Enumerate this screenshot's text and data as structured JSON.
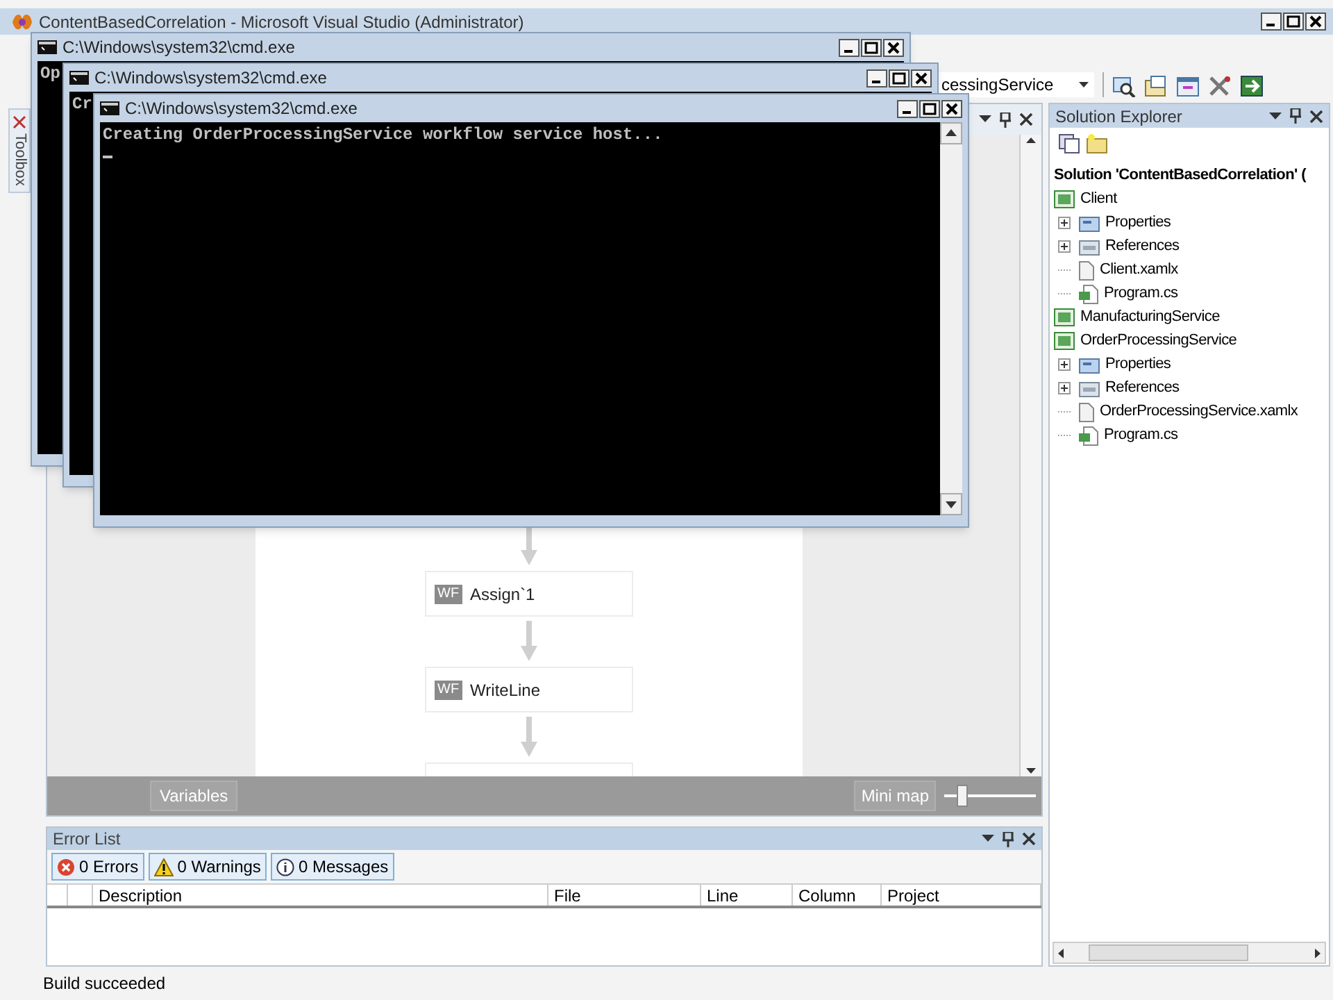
{
  "window": {
    "title": "ContentBasedCorrelation - Microsoft Visual Studio (Administrator)"
  },
  "toolbar": {
    "dropdown": "cessingService"
  },
  "toolbox": {
    "label": "Toolbox"
  },
  "designer": {
    "activities": [
      {
        "icon_label": "WF",
        "label": "Assign`1"
      },
      {
        "icon_label": "WF",
        "label": "WriteLine"
      }
    ],
    "variables_button": "Variables",
    "minimap_button": "Mini map",
    "zoom": {
      "level": 0.15
    }
  },
  "error_list": {
    "title": "Error List",
    "filters": [
      {
        "kind": "error",
        "label": "0 Errors",
        "selected": true
      },
      {
        "kind": "warning",
        "label": "0 Warnings",
        "selected": true
      },
      {
        "kind": "message",
        "label": "0 Messages",
        "selected": true
      }
    ],
    "columns": [
      "Description",
      "File",
      "Line",
      "Column",
      "Project"
    ]
  },
  "status_bar": "Build succeeded",
  "solution_explorer": {
    "title": "Solution Explorer",
    "tree": [
      {
        "kind": "solution",
        "label": "Solution 'ContentBasedCorrelation' (",
        "children": [
          {
            "kind": "project",
            "label": "Client",
            "children": [
              {
                "kind": "properties",
                "label": "Properties",
                "expanded": false
              },
              {
                "kind": "references",
                "label": "References",
                "expanded": false
              },
              {
                "kind": "file",
                "label": "Client.xamlx"
              },
              {
                "kind": "code",
                "label": "Program.cs"
              }
            ]
          },
          {
            "kind": "project",
            "label": "ManufacturingService"
          },
          {
            "kind": "project",
            "label": "OrderProcessingService",
            "children": [
              {
                "kind": "properties",
                "label": "Properties",
                "expanded": false
              },
              {
                "kind": "references",
                "label": "References",
                "expanded": false
              },
              {
                "kind": "file",
                "label": "OrderProcessingService.xamlx"
              },
              {
                "kind": "code",
                "label": "Program.cs"
              }
            ]
          }
        ]
      }
    ]
  },
  "consoles": [
    {
      "title": "C:\\Windows\\system32\\cmd.exe",
      "lines": [
        "Op"
      ]
    },
    {
      "title": "C:\\Windows\\system32\\cmd.exe",
      "lines": [
        "Cr"
      ]
    },
    {
      "title": "C:\\Windows\\system32\\cmd.exe",
      "lines": [
        "Creating OrderProcessingService workflow service host..."
      ],
      "cursor": true
    }
  ]
}
